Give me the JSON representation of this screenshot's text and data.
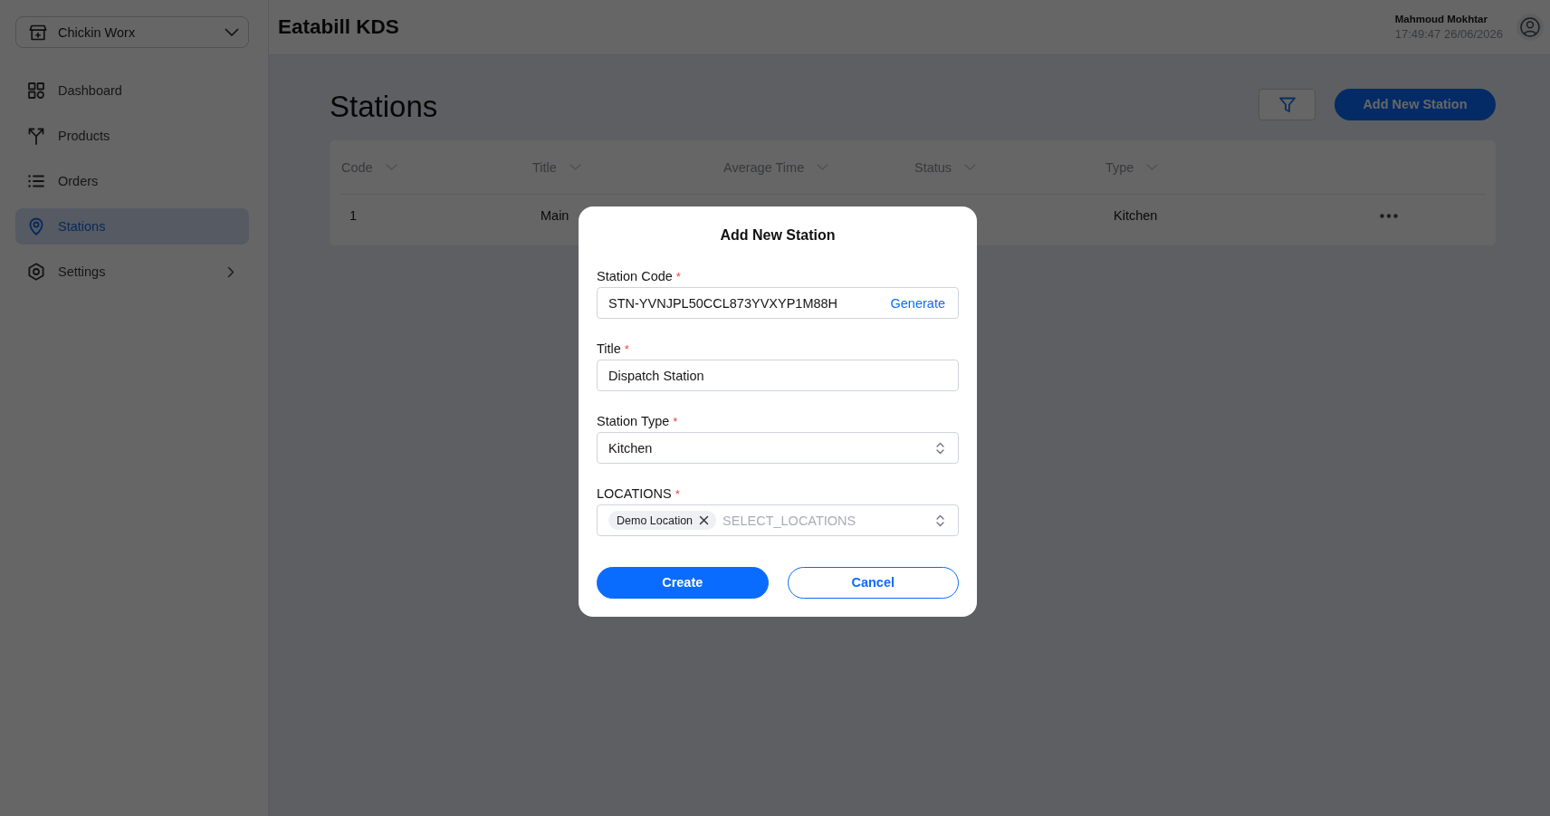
{
  "sidebar": {
    "store_selector": {
      "value": "Chickin Worx"
    },
    "items": [
      {
        "kind": "link",
        "label": "Dashboard",
        "selected": false
      },
      {
        "kind": "link",
        "label": "Products",
        "selected": false
      },
      {
        "kind": "link",
        "label": "Orders",
        "selected": false
      },
      {
        "kind": "link",
        "label": "Stations",
        "selected": true
      },
      {
        "kind": "group",
        "label": "Settings",
        "selected": false,
        "expanded": false
      }
    ]
  },
  "header": {
    "title": "Eatabill KDS",
    "user": {
      "name": "Mahmoud Mokhtar",
      "timestamp": "17:49:47 26/06/2026"
    }
  },
  "page": {
    "title": "Stations",
    "add_button": {
      "label": "Add New Station"
    }
  },
  "table": {
    "columns": [
      {
        "label": "Code"
      },
      {
        "label": "Title"
      },
      {
        "label": "Average Time"
      },
      {
        "label": "Status"
      },
      {
        "label": "Type"
      }
    ],
    "rows": [
      {
        "code": "1",
        "title": "Main",
        "type": "Kitchen"
      }
    ]
  },
  "modal": {
    "title": "Add New Station",
    "fields": [
      {
        "kind": "text",
        "label": "Station Code",
        "required_mark": "*",
        "value": "STN-YVNJPL50CCL873YVXYP1M88H",
        "action": "Generate"
      },
      {
        "kind": "text",
        "label": "Title",
        "required_mark": "*",
        "value": "Dispatch Station"
      },
      {
        "kind": "select",
        "label": "Station Type",
        "required_mark": "*",
        "value": "Kitchen"
      },
      {
        "kind": "multiselect",
        "label": "LOCATIONS",
        "required_mark": "*",
        "tags": [
          "Demo Location"
        ],
        "placeholder": "SELECT_LOCATIONS"
      }
    ],
    "buttons": [
      {
        "kind": "primary",
        "label": "Create"
      },
      {
        "kind": "secondary",
        "label": "Cancel"
      }
    ]
  }
}
